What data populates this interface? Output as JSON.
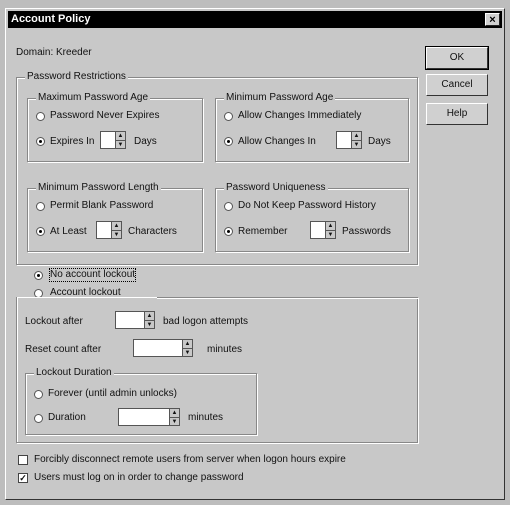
{
  "window": {
    "title": "Account Policy",
    "close": "×"
  },
  "domain": "Domain: Kreeder",
  "buttons": {
    "ok": "OK",
    "cancel": "Cancel",
    "help": "Help"
  },
  "password_restrictions": {
    "legend": "Password Restrictions",
    "max_age": {
      "legend": "Maximum Password Age",
      "never": "Password Never Expires",
      "expires_in": "Expires In",
      "days": "Days"
    },
    "min_age": {
      "legend": "Minimum Password Age",
      "immediately": "Allow Changes Immediately",
      "allow_in": "Allow Changes In",
      "days": "Days"
    },
    "min_length": {
      "legend": "Minimum Password Length",
      "blank": "Permit Blank Password",
      "at_least": "At Least",
      "characters": "Characters"
    },
    "uniqueness": {
      "legend": "Password Uniqueness",
      "no_history": "Do Not Keep Password History",
      "remember": "Remember",
      "passwords": "Passwords"
    }
  },
  "lockout": {
    "no_lockout": "No account lockout",
    "account_lockout": "Account lockout",
    "lockout_after": "Lockout after",
    "bad_attempts": "bad logon attempts",
    "reset_count": "Reset count after",
    "minutes": "minutes",
    "duration": {
      "legend": "Lockout Duration",
      "forever": "Forever (until admin unlocks)",
      "duration": "Duration",
      "minutes": "minutes"
    }
  },
  "options": {
    "disconnect": {
      "label": "Forcibly disconnect remote users from server when logon hours expire",
      "checked": false
    },
    "must_logon": {
      "label": "Users must log on in order to change password",
      "checked": true,
      "mark": "✓"
    }
  }
}
